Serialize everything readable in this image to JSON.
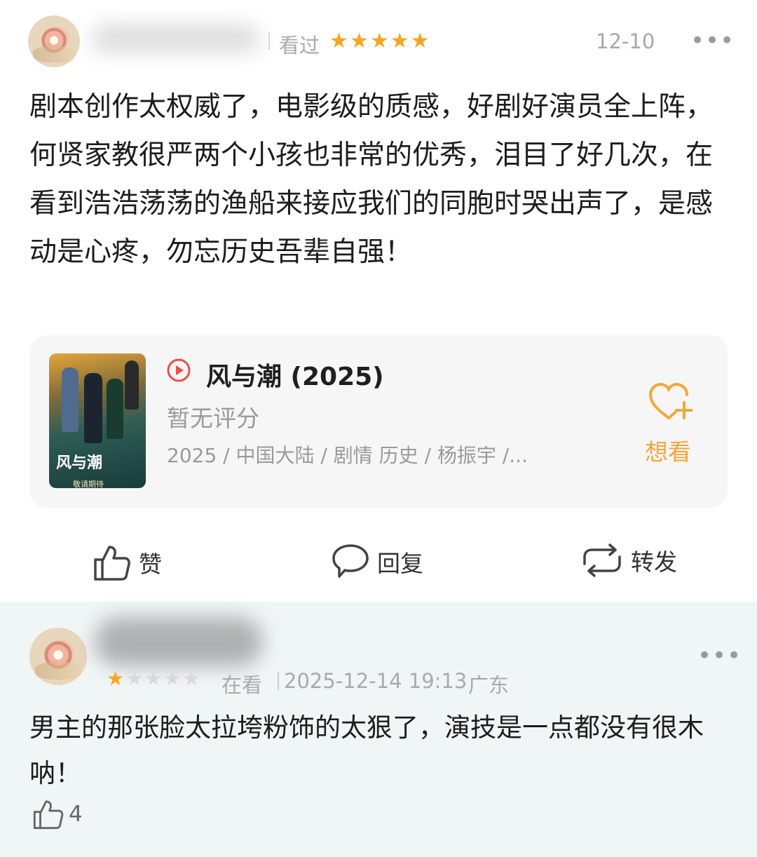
{
  "review": {
    "status": "看过",
    "rating": 5,
    "date": "12-10",
    "more": "•••",
    "text": "剧本创作太权威了，电影级的质感，好剧好演员全上阵，何贤家教很严两个小孩也非常的优秀，泪目了好几次，在看到浩浩荡荡的渔船来接应我们的同胞时哭出声了，是感动是心疼，勿忘历史吾辈自强！"
  },
  "show_card": {
    "title": "风与潮 (2025)",
    "score": "暂无评分",
    "info": "2025 / 中国大陆 / 剧情 历史 / 杨振宇 /...",
    "poster_title": "风与潮",
    "poster_tag": "敬请期待",
    "want_label": "想看",
    "accent": "#f3a73a",
    "play_color": "#e8504a"
  },
  "actions": {
    "like": "赞",
    "reply": "回复",
    "share": "转发"
  },
  "reply": {
    "rating": 1,
    "status": "在看",
    "time": "2025-12-14 19:13",
    "location": "广东",
    "more": "•••",
    "text": "男主的那张脸太拉垮粉饰的太狠了，演技是一点都没有很木呐！",
    "likes": "4"
  }
}
